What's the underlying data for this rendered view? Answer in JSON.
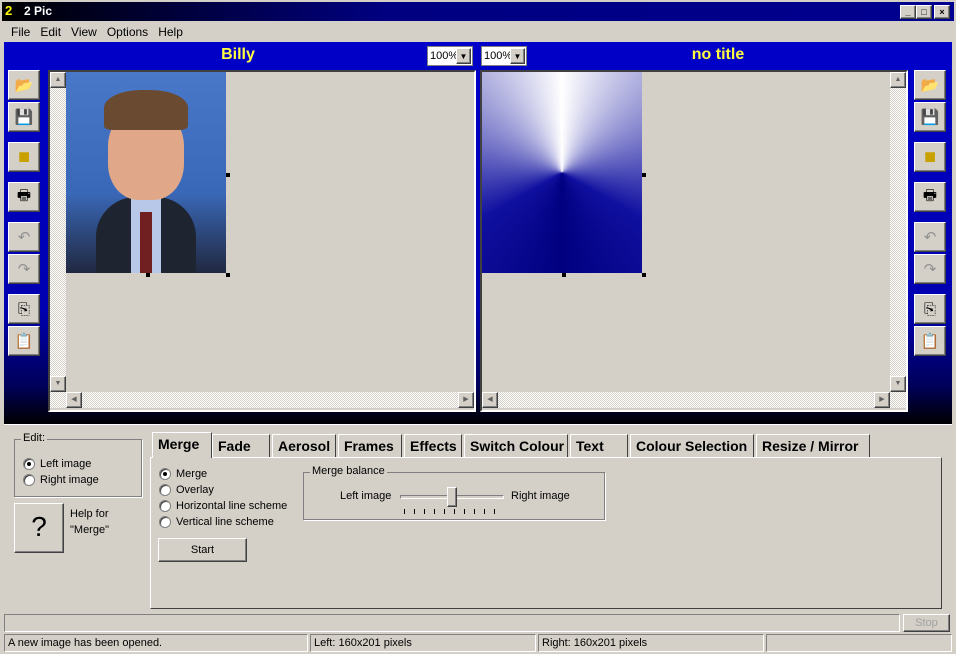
{
  "window": {
    "title": "2 Pic",
    "min": "_",
    "max": "□",
    "close": "×"
  },
  "menu": [
    "File",
    "Edit",
    "View",
    "Options",
    "Help"
  ],
  "left_panel": {
    "title": "Billy",
    "zoom": "100%"
  },
  "right_panel": {
    "title": "no title",
    "zoom": "100%"
  },
  "toolbar_icons": [
    "open-folder-icon",
    "save-icon",
    "color-icon",
    "print-icon",
    "undo-icon",
    "redo-icon",
    "copy-icon",
    "paste-icon"
  ],
  "edit_group": {
    "label": "Edit:",
    "options": [
      "Left image",
      "Right image"
    ],
    "selected": 0
  },
  "help": {
    "glyph": "?",
    "text1": "Help for",
    "text2": "\"Merge\""
  },
  "tabs": [
    "Merge",
    "Fade",
    "Aerosol",
    "Frames",
    "Effects",
    "Switch Colour",
    "Text",
    "Colour Selection",
    "Resize / Mirror"
  ],
  "active_tab": 0,
  "merge": {
    "options": [
      "Merge",
      "Overlay",
      "Horizontal line scheme",
      "Vertical line scheme"
    ],
    "selected": 0,
    "balance_label": "Merge balance",
    "left_label": "Left image",
    "right_label": "Right image",
    "balance_value": 0.5,
    "start": "Start"
  },
  "stop": "Stop",
  "status": {
    "message": "A new image has been opened.",
    "left": "Left: 160x201 pixels",
    "right": "Right: 160x201 pixels"
  }
}
